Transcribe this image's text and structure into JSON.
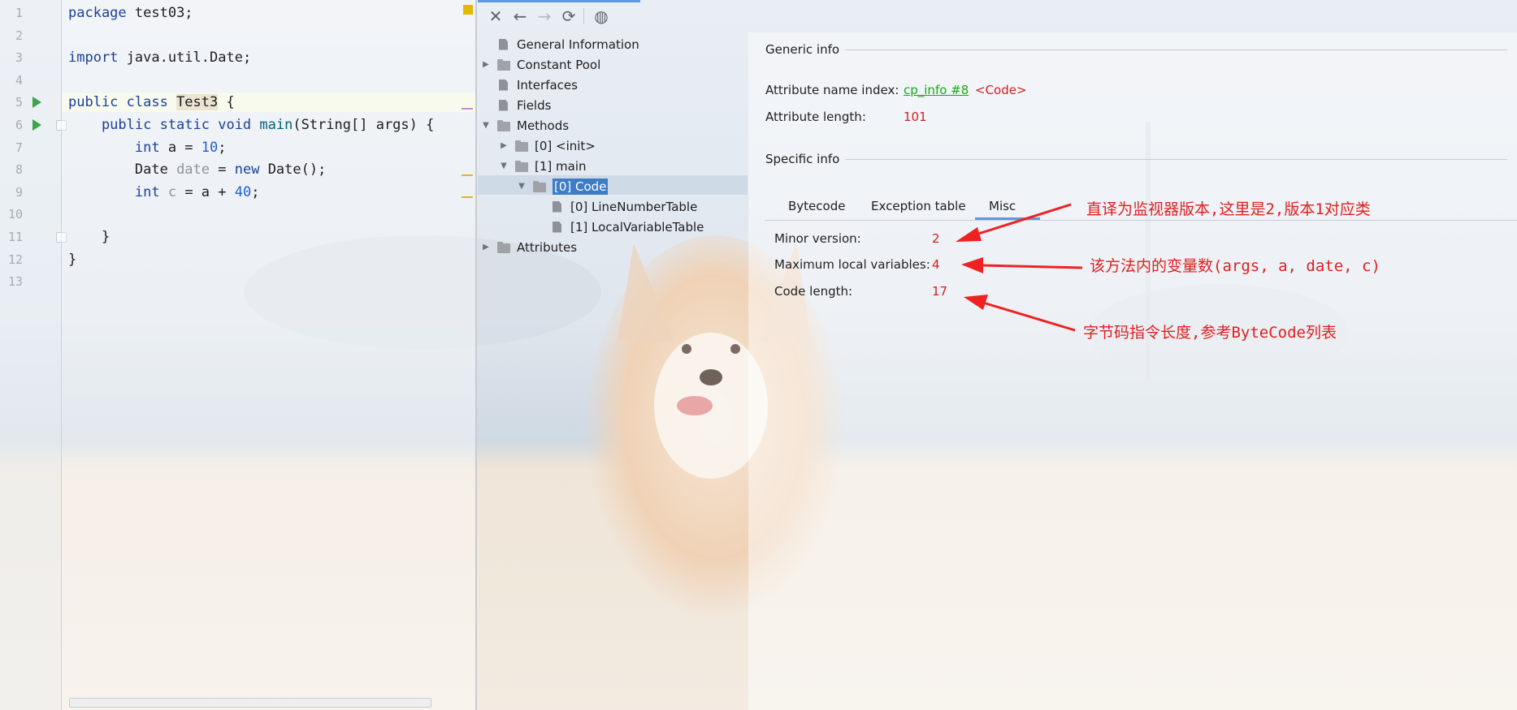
{
  "editor": {
    "line_numbers": [
      "1",
      "2",
      "3",
      "4",
      "5",
      "6",
      "7",
      "8",
      "9",
      "10",
      "11",
      "12",
      "13"
    ],
    "lines": [
      {
        "segments": [
          {
            "text": "package ",
            "cls": "kw"
          },
          {
            "text": "test03;",
            "cls": ""
          }
        ]
      },
      {
        "segments": []
      },
      {
        "segments": [
          {
            "text": "import ",
            "cls": "kw"
          },
          {
            "text": "java.util.Date;",
            "cls": ""
          }
        ]
      },
      {
        "segments": []
      },
      {
        "segments": [
          {
            "text": "public class ",
            "cls": "kw"
          },
          {
            "text": "Test3",
            "cls": "hl-word"
          },
          {
            "text": " {",
            "cls": ""
          }
        ]
      },
      {
        "segments": [
          {
            "text": "    public static void ",
            "cls": "kw"
          },
          {
            "text": "main",
            "cls": "fn"
          },
          {
            "text": "(String[] args) {",
            "cls": ""
          }
        ]
      },
      {
        "segments": [
          {
            "text": "        int ",
            "cls": "kw"
          },
          {
            "text": "a = ",
            "cls": ""
          },
          {
            "text": "10",
            "cls": "num"
          },
          {
            "text": ";",
            "cls": ""
          }
        ]
      },
      {
        "segments": [
          {
            "text": "        Date ",
            "cls": ""
          },
          {
            "text": "date",
            "cls": "unused"
          },
          {
            "text": " = ",
            "cls": ""
          },
          {
            "text": "new ",
            "cls": "kw"
          },
          {
            "text": "Date();",
            "cls": ""
          }
        ]
      },
      {
        "segments": [
          {
            "text": "        int ",
            "cls": "kw"
          },
          {
            "text": "c",
            "cls": "unused"
          },
          {
            "text": " = a + ",
            "cls": ""
          },
          {
            "text": "40",
            "cls": "num"
          },
          {
            "text": ";",
            "cls": ""
          }
        ]
      },
      {
        "segments": []
      },
      {
        "segments": [
          {
            "text": "    }",
            "cls": ""
          }
        ]
      },
      {
        "segments": [
          {
            "text": "}",
            "cls": ""
          }
        ]
      },
      {
        "segments": []
      }
    ]
  },
  "toolbar": {
    "icons": [
      "close-icon",
      "back-icon",
      "forward-icon",
      "refresh-icon",
      "web-icon"
    ],
    "glyphs": [
      "✕",
      "←",
      "→",
      "⟳",
      "◍"
    ]
  },
  "tree": {
    "nodes": [
      {
        "label": "General Information",
        "icon": "file",
        "arrow": ""
      },
      {
        "label": "Constant Pool",
        "icon": "folder",
        "arrow": "▶"
      },
      {
        "label": "Interfaces",
        "icon": "file",
        "arrow": ""
      },
      {
        "label": "Fields",
        "icon": "file",
        "arrow": ""
      },
      {
        "label": "Methods",
        "icon": "folder",
        "arrow": "▼"
      },
      {
        "label": "[0] <init>",
        "icon": "folder",
        "arrow": "▶"
      },
      {
        "label": "[1] main",
        "icon": "folder",
        "arrow": "▼"
      },
      {
        "label": "[0] Code",
        "icon": "folder",
        "arrow": "▼",
        "selected": true
      },
      {
        "label": "[0] LineNumberTable",
        "icon": "file",
        "arrow": ""
      },
      {
        "label": "[1] LocalVariableTable",
        "icon": "file",
        "arrow": ""
      },
      {
        "label": "Attributes",
        "icon": "folder",
        "arrow": "▶"
      }
    ]
  },
  "detail": {
    "generic_title": "Generic info",
    "attr_name_index_label": "Attribute name index:",
    "attr_name_index_link": "cp_info #8",
    "attr_name_index_value": "<Code>",
    "attr_length_label": "Attribute length:",
    "attr_length_value": "101",
    "specific_title": "Specific info",
    "tabs": [
      "Bytecode",
      "Exception table",
      "Misc"
    ],
    "active_tab": "Misc",
    "minor_version_label": "Minor version:",
    "minor_version_value": "2",
    "max_locals_label": "Maximum local variables:",
    "max_locals_value": "4",
    "code_length_label": "Code length:",
    "code_length_value": "17"
  },
  "annotations": {
    "note1": "直译为监视器版本,这里是2,版本1对应类",
    "note2": "该方法内的变量数(args, a, date, c)",
    "note3": "字节码指令长度,参考ByteCode列表"
  },
  "colors": {
    "keyword": "#1c3f9c",
    "number": "#1f5fd6",
    "selection": "#3d7cc6",
    "value_red": "#d0201e",
    "link_green": "#1aa81a",
    "annotation_red": "#e02020"
  }
}
